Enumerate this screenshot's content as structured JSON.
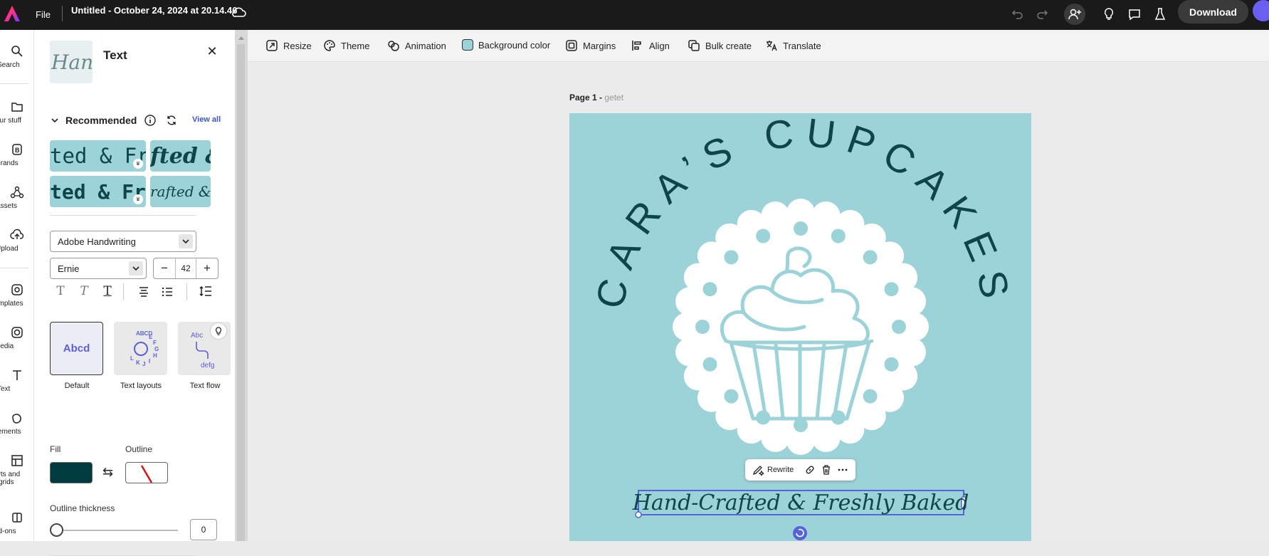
{
  "topbar": {
    "file_label": "File",
    "doc_title": "Untitled - October 24, 2024 at 20.14.46",
    "download_label": "Download"
  },
  "leftnav": {
    "items": [
      {
        "label": "Search",
        "icon": "search-icon"
      },
      {
        "label": "our stuff",
        "icon": "folder-icon"
      },
      {
        "label": "Brands",
        "icon": "brand-icon"
      },
      {
        "label": "Assets",
        "icon": "assets-icon"
      },
      {
        "label": "Upload",
        "icon": "upload-icon"
      },
      {
        "label": "emplates",
        "icon": "templates-icon"
      },
      {
        "label": "Media",
        "icon": "media-icon"
      },
      {
        "label": "Text",
        "icon": "text-icon"
      },
      {
        "label": "Elements",
        "icon": "elements-icon"
      },
      {
        "label": "arts and",
        "label2": "grids",
        "icon": "charts-icon"
      },
      {
        "label": "dd-ons",
        "icon": "addons-icon"
      }
    ]
  },
  "panel": {
    "thumb_text": "Han",
    "title": "Text",
    "recommended_label": "Recommended",
    "view_all": "View all",
    "presets": [
      "ted & Fre",
      "fted & ",
      "ted & Fres",
      "rafted & "
    ],
    "font_family": "Adobe Handwriting",
    "font_style": "Ernie",
    "font_size": "42",
    "layouts": [
      {
        "label": "Default",
        "preview": "Abcd"
      },
      {
        "label": "Text layouts",
        "preview": "ABCDEFGHIJKL"
      },
      {
        "label": "Text flow",
        "preview": "Abc defg"
      }
    ],
    "fill_label": "Fill",
    "outline_label": "Outline",
    "outline_thickness_label": "Outline thickness",
    "outline_thickness_value": "0",
    "outline_thickness_fraction": 0
  },
  "toolbar": {
    "tools": [
      {
        "label": "Resize",
        "icon": "resize-icon"
      },
      {
        "label": "Theme",
        "icon": "theme-icon"
      },
      {
        "label": "Animation",
        "icon": "animation-icon"
      },
      {
        "label": "Background color",
        "icon": "background-color-swatch"
      },
      {
        "label": "Margins",
        "icon": "margins-icon"
      },
      {
        "label": "Align",
        "icon": "align-icon"
      },
      {
        "label": "Bulk create",
        "icon": "bulk-create-icon"
      },
      {
        "label": "Translate",
        "icon": "translate-icon"
      }
    ]
  },
  "canvas": {
    "page_label": "Page 1 -",
    "page_name": "getet",
    "arc_text": "CARA’S CUPCAKES",
    "tagline": "Hand-Crafted & Freshly Baked",
    "context_menu": {
      "rewrite": "Rewrite"
    }
  },
  "colors": {
    "artboard": "#9bd3d9",
    "ink": "#0f4449",
    "fill_swatch": "#003c3f",
    "accent": "#3a52d8",
    "topbar": "#1a1a1a"
  }
}
